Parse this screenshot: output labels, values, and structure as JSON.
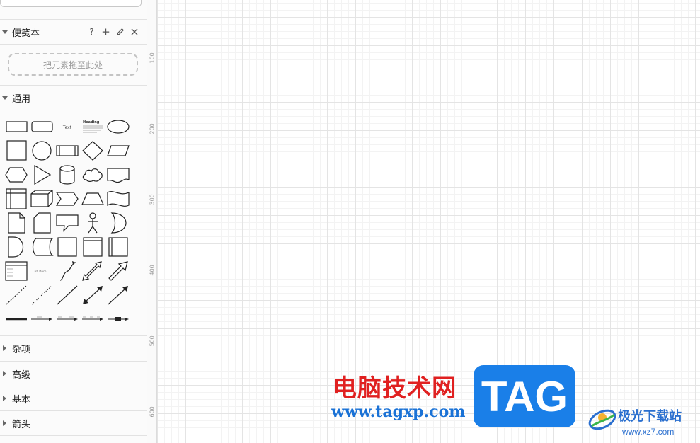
{
  "search": {
    "value": ""
  },
  "scratchpad": {
    "title": "便笺本",
    "tools": {
      "help": "?",
      "add": "+"
    },
    "drop_hint": "把元素拖至此处"
  },
  "general": {
    "title": "通用",
    "shape_texts": {
      "text": "Text",
      "heading": "Heading",
      "list_item": "List Item"
    }
  },
  "collapsed_sections": [
    {
      "label": "杂项"
    },
    {
      "label": "高级"
    },
    {
      "label": "基本"
    },
    {
      "label": "箭头"
    }
  ],
  "ruler": {
    "labels": [
      "100",
      "200",
      "300",
      "400",
      "500",
      "600"
    ]
  },
  "watermark": {
    "title": "电脑技术网",
    "url": "www.tagxp.com",
    "tag": "TAG",
    "site_name": "极光下载站",
    "site_url": "www.xz7.com"
  },
  "colors": {
    "watermark_red": "#e02020",
    "watermark_blue": "#1a7fe8",
    "grid": "#e4e4e4"
  }
}
